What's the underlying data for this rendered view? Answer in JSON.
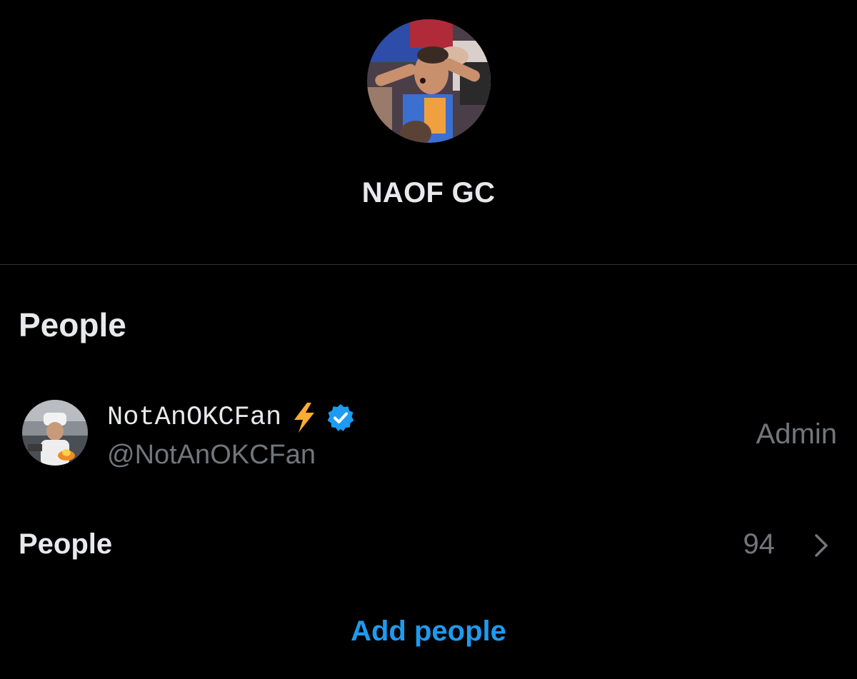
{
  "header": {
    "group_avatar_icon": "group-photo",
    "group_name": "NAOF GC"
  },
  "people_section": {
    "title": "People",
    "members": [
      {
        "display_name": "NotAnOKCFan",
        "emoji_icon": "lightning-bolt-icon",
        "verified_icon": "verified-badge-icon",
        "handle": "@NotAnOKCFan",
        "role": "Admin"
      }
    ],
    "people_row": {
      "label": "People",
      "count": "94",
      "chevron_icon": "chevron-right-icon"
    },
    "add_people_label": "Add people"
  },
  "colors": {
    "background": "#000000",
    "primary_text": "#e7e9ea",
    "secondary_text": "#71767b",
    "accent": "#1d9bf0",
    "divider": "#333639",
    "bolt": "#ffac33"
  }
}
